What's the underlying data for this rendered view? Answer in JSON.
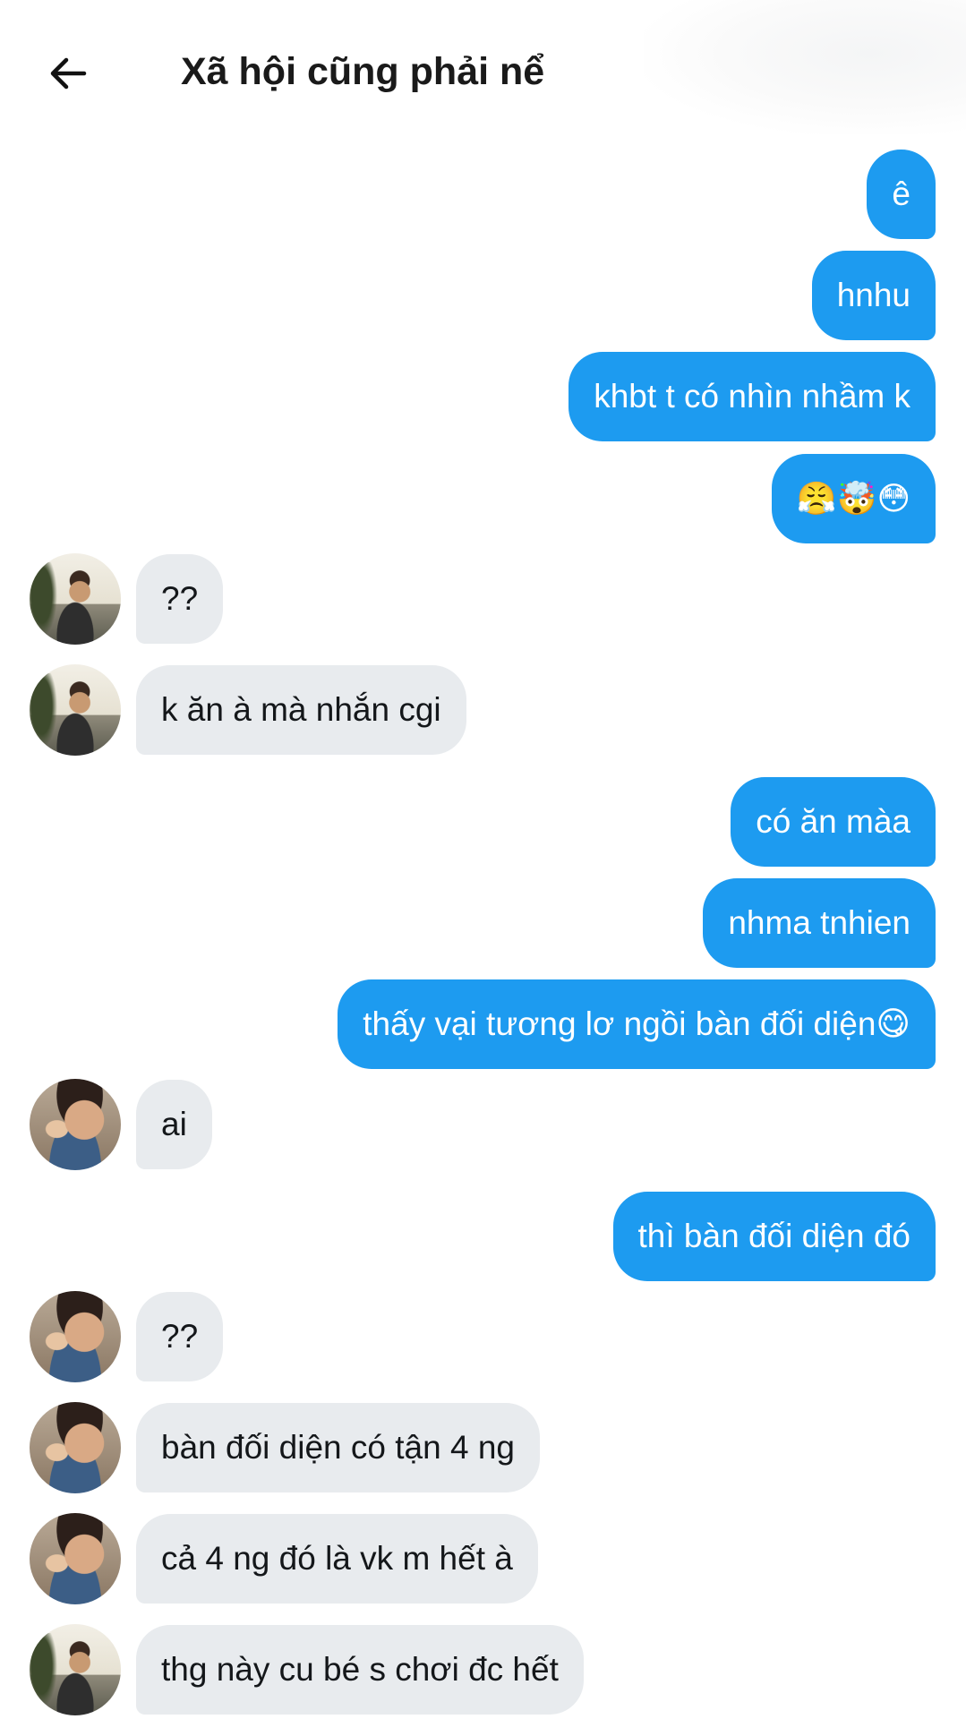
{
  "header": {
    "title": "Xã hội cũng phải nể"
  },
  "colors": {
    "outgoing_bubble": "#1d9bf0",
    "incoming_bubble": "#e8ebee"
  },
  "messages": [
    {
      "dir": "out",
      "text": "ê"
    },
    {
      "dir": "out",
      "text": "hnhu"
    },
    {
      "dir": "out",
      "text": "khbt t có nhìn nhầm k"
    },
    {
      "dir": "out",
      "text": "😤🤯😳"
    },
    {
      "dir": "in",
      "avatar": "avatar-a",
      "text": "??"
    },
    {
      "dir": "in",
      "avatar": "avatar-a",
      "text": "k ăn à mà nhắn cgi"
    },
    {
      "dir": "out",
      "text": "có ăn màa"
    },
    {
      "dir": "out",
      "text": "nhma tnhien"
    },
    {
      "dir": "out",
      "text": "thấy vại tương lơ ngồi bàn đối diện😋"
    },
    {
      "dir": "in",
      "avatar": "avatar-b",
      "text": "ai"
    },
    {
      "dir": "out",
      "text": "thì bàn đối diện đó"
    },
    {
      "dir": "in",
      "avatar": "avatar-b",
      "text": "??"
    },
    {
      "dir": "in",
      "avatar": "avatar-b",
      "text": "bàn đối diện có tận 4 ng"
    },
    {
      "dir": "in",
      "avatar": "avatar-b",
      "text": "cả 4 ng đó là vk m hết à"
    },
    {
      "dir": "in",
      "avatar": "avatar-a",
      "text": "thg này cu bé s chơi đc hết"
    }
  ]
}
